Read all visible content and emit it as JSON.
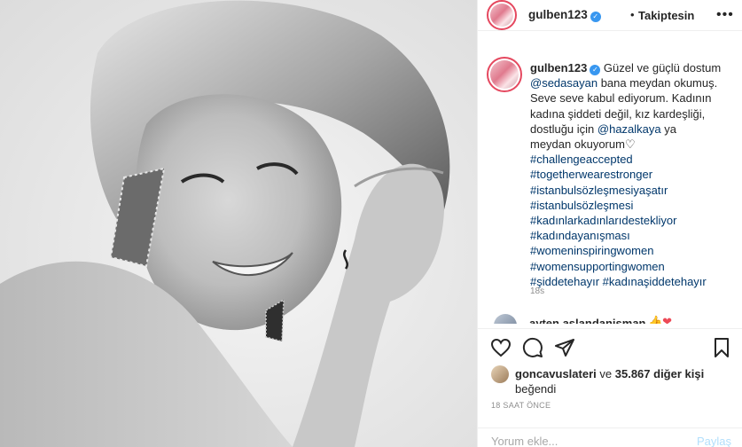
{
  "post": {
    "username": "gulben123",
    "verified_glyph": "✓",
    "follow_status": "Takiptesin",
    "dot": "•",
    "more_glyph": "•••",
    "caption_lines": [
      "Güzel ve güçlü dostum",
      "@sedasayan bana meydan okumuş.",
      "Seve seve kabul ediyorum. Kadının",
      "kadına şiddeti değil, kız kardeşliği,",
      "dostluğu için @hazalkaya ya",
      "meydan okuyorum♡"
    ],
    "hashtags": [
      "#challengeaccepted",
      "#togetherwearestronger",
      "#istanbulsözleşmesiyaşatır",
      "#istanbulsözleşmesi",
      "#kadınlarkadınlarıdestekliyor",
      "#kadındayanışması",
      "#womeninspiringwomen",
      "#womensupportingwomen"
    ],
    "hashtag_last_line": "#şiddetehayır #kadınaşiddetehayır",
    "caption_time": "18s"
  },
  "second_comment": {
    "username": "ayten.aslandanisman",
    "emoji": "👍❤"
  },
  "actions": {
    "like_icon": "heart-outline",
    "comment_icon": "speech-bubble",
    "share_icon": "paper-plane",
    "save_icon": "bookmark"
  },
  "likes": {
    "user": "goncavuslateri",
    "connector": "ve",
    "count_text": "35.867 diğer kişi",
    "suffix": "beğendi"
  },
  "time_ago": "18 SAAT ÖNCE",
  "add_comment": {
    "placeholder": "Yorum ekle...",
    "post_label": "Paylaş"
  },
  "colors": {
    "link": "#00376b",
    "verified": "#3897f0",
    "muted": "#8e8e8e",
    "post_button": "#b2dffc"
  }
}
